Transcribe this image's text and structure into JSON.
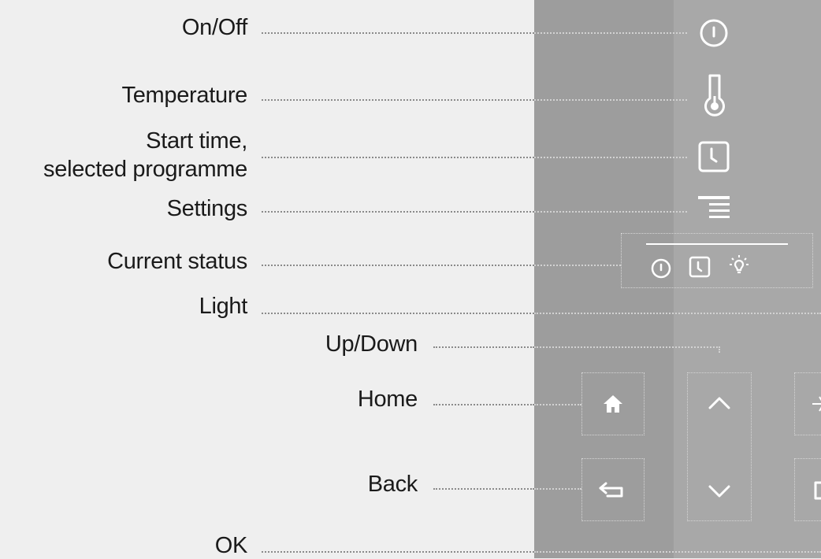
{
  "labels": {
    "on_off": "On/Off",
    "temperature": "Temperature",
    "start_time_line1": "Start time,",
    "start_time_line2": "selected programme",
    "settings": "Settings",
    "current_status": "Current status",
    "light": "Light",
    "up_down": "Up/Down",
    "home": "Home",
    "back": "Back",
    "ok": "OK"
  },
  "icons": [
    "power-icon",
    "thermometer-icon",
    "clock-icon",
    "menu-icon",
    "status-power-icon",
    "status-clock-icon",
    "status-light-icon",
    "home-icon",
    "chevron-up-icon",
    "chevron-down-icon",
    "back-arrow-icon",
    "light-icon",
    "ok-icon"
  ],
  "colors": {
    "background": "#efefef",
    "panel_dark": "#9d9d9d",
    "panel_light": "#a8a8a8",
    "icon": "#ffffff",
    "text": "#1a1a1a"
  }
}
